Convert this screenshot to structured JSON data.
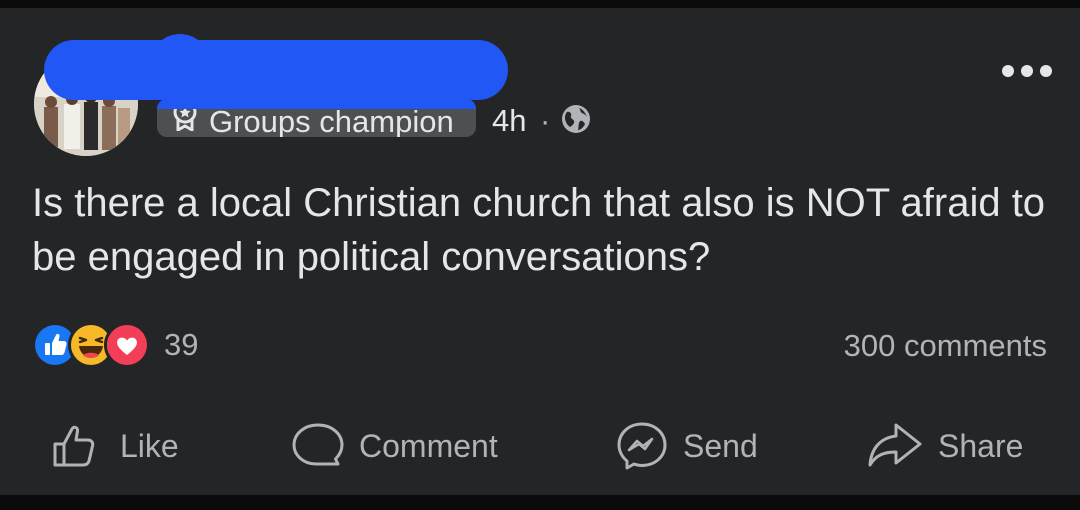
{
  "post": {
    "badge_label": "Groups champion",
    "timestamp": "4h",
    "separator": "·",
    "audience_icon": "globe-icon",
    "text": "Is there a local Christian church that also is NOT afraid to be engaged in political conversations?"
  },
  "reactions": {
    "icons": [
      "like-reaction-icon",
      "haha-reaction-icon",
      "love-reaction-icon"
    ],
    "count": "39"
  },
  "comments_label": "300 comments",
  "actions": {
    "like": "Like",
    "comment": "Comment",
    "send": "Send",
    "share": "Share"
  },
  "colors": {
    "background": "#242526",
    "text": "#e4e6eb",
    "secondary_text": "#b0b3b8",
    "redaction": "#2057f5",
    "like_blue": "#1877f2",
    "love_red": "#f33e58",
    "haha_yellow": "#f7b928"
  }
}
